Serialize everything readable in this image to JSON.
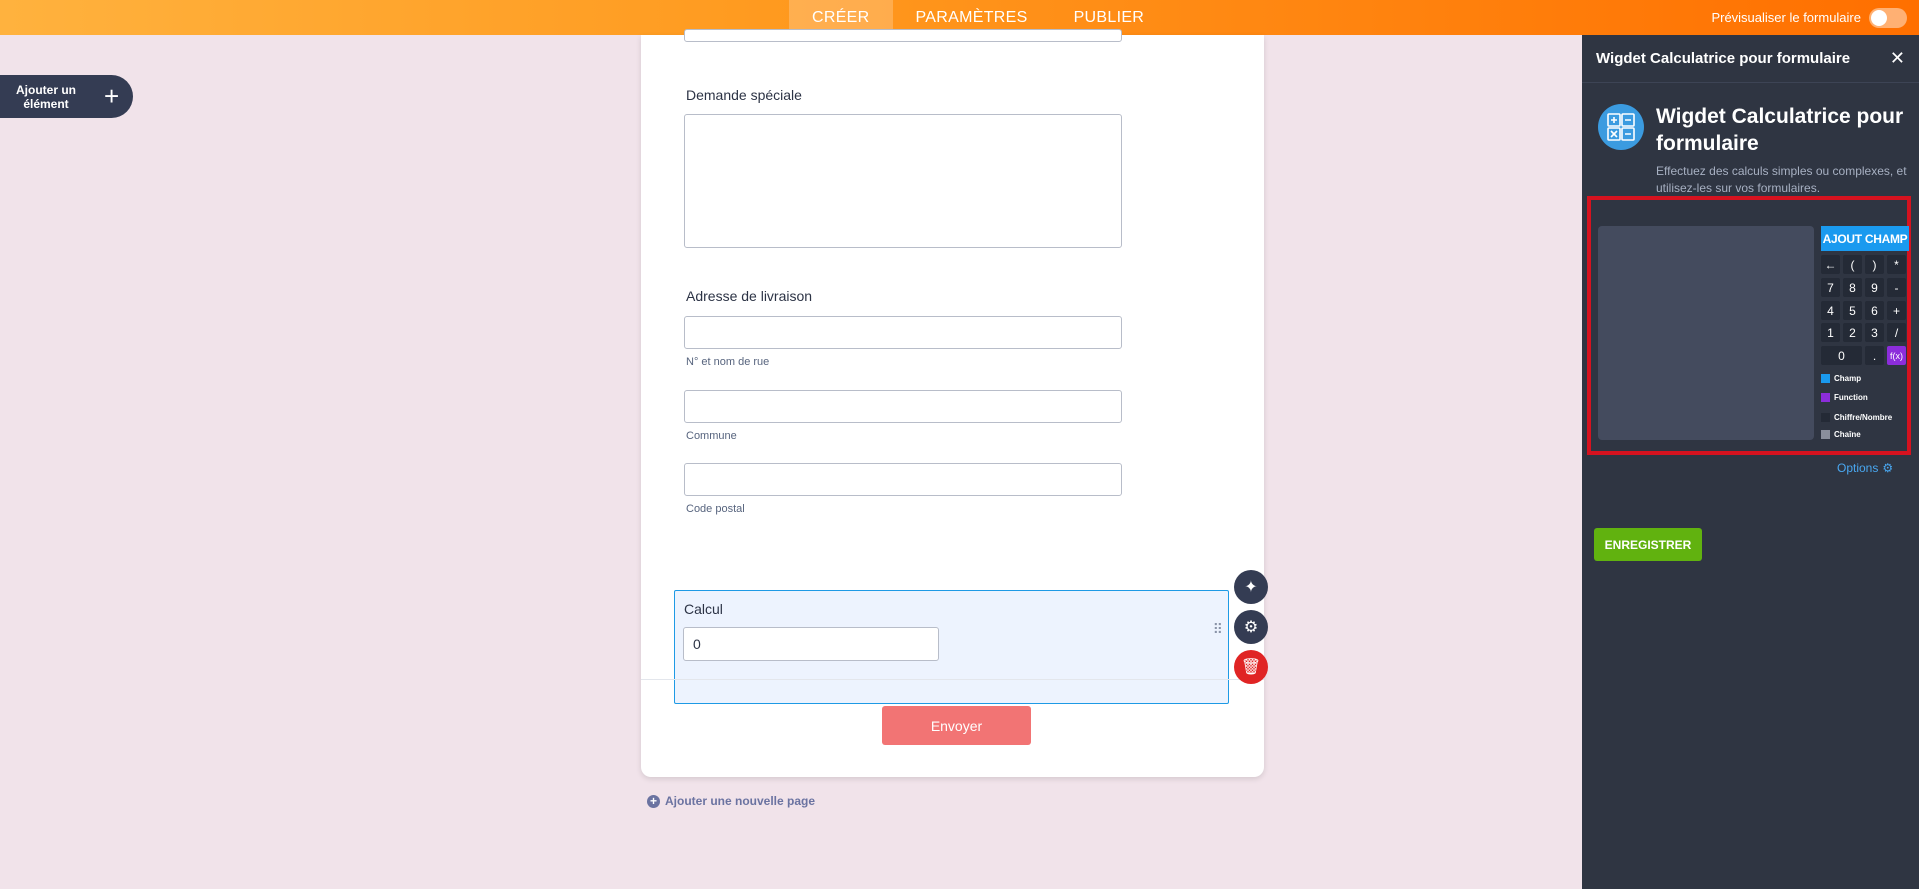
{
  "topbar": {
    "tabs": [
      {
        "label": "CRÉER",
        "active": true
      },
      {
        "label": "PARAMÈTRES",
        "active": false
      },
      {
        "label": "PUBLIER",
        "active": false
      }
    ],
    "preview_label": "Prévisualiser le formulaire"
  },
  "add_element": {
    "label": "Ajouter un élément",
    "icon": "plus-icon"
  },
  "form": {
    "special_request_label": "Demande spéciale",
    "address_label": "Adresse de livraison",
    "street_sublabel": "N° et nom de rue",
    "city_sublabel": "Commune",
    "zip_sublabel": "Code postal",
    "calc_label": "Calcul",
    "calc_value": "0",
    "submit_label": "Envoyer",
    "add_page_label": "Ajouter une nouvelle page"
  },
  "panel": {
    "header_title": "Wigdet Calculatrice pour formulaire",
    "widget_title": "Wigdet Calculatrice pour formulaire",
    "widget_desc": "Effectuez des calculs simples ou complexes, et utilisez-les sur vos formulaires.",
    "add_field_label": "AJOUT CHAMP",
    "keys": [
      [
        "←",
        "(",
        ")",
        "*"
      ],
      [
        "7",
        "8",
        "9",
        "-"
      ],
      [
        "4",
        "5",
        "6",
        "+"
      ],
      [
        "1",
        "2",
        "3",
        "/"
      ]
    ],
    "last_row": {
      "zero": "0",
      "dot": ".",
      "fx": "f(x)"
    },
    "legend": [
      {
        "label": "Champ",
        "color": "#1a9aef"
      },
      {
        "label": "Function",
        "color": "#8c2ddb"
      },
      {
        "label": "Chiffre/Nombre",
        "color": "#242a36"
      },
      {
        "label": "Chaîne",
        "color": "#8a8f9c"
      }
    ],
    "options_label": "Options",
    "save_label": "ENREGISTRER"
  },
  "colors": {
    "accent": "#ff8a1f",
    "highlight_frame": "#d6121f",
    "submit": "#f27474",
    "save": "#61b20f"
  }
}
